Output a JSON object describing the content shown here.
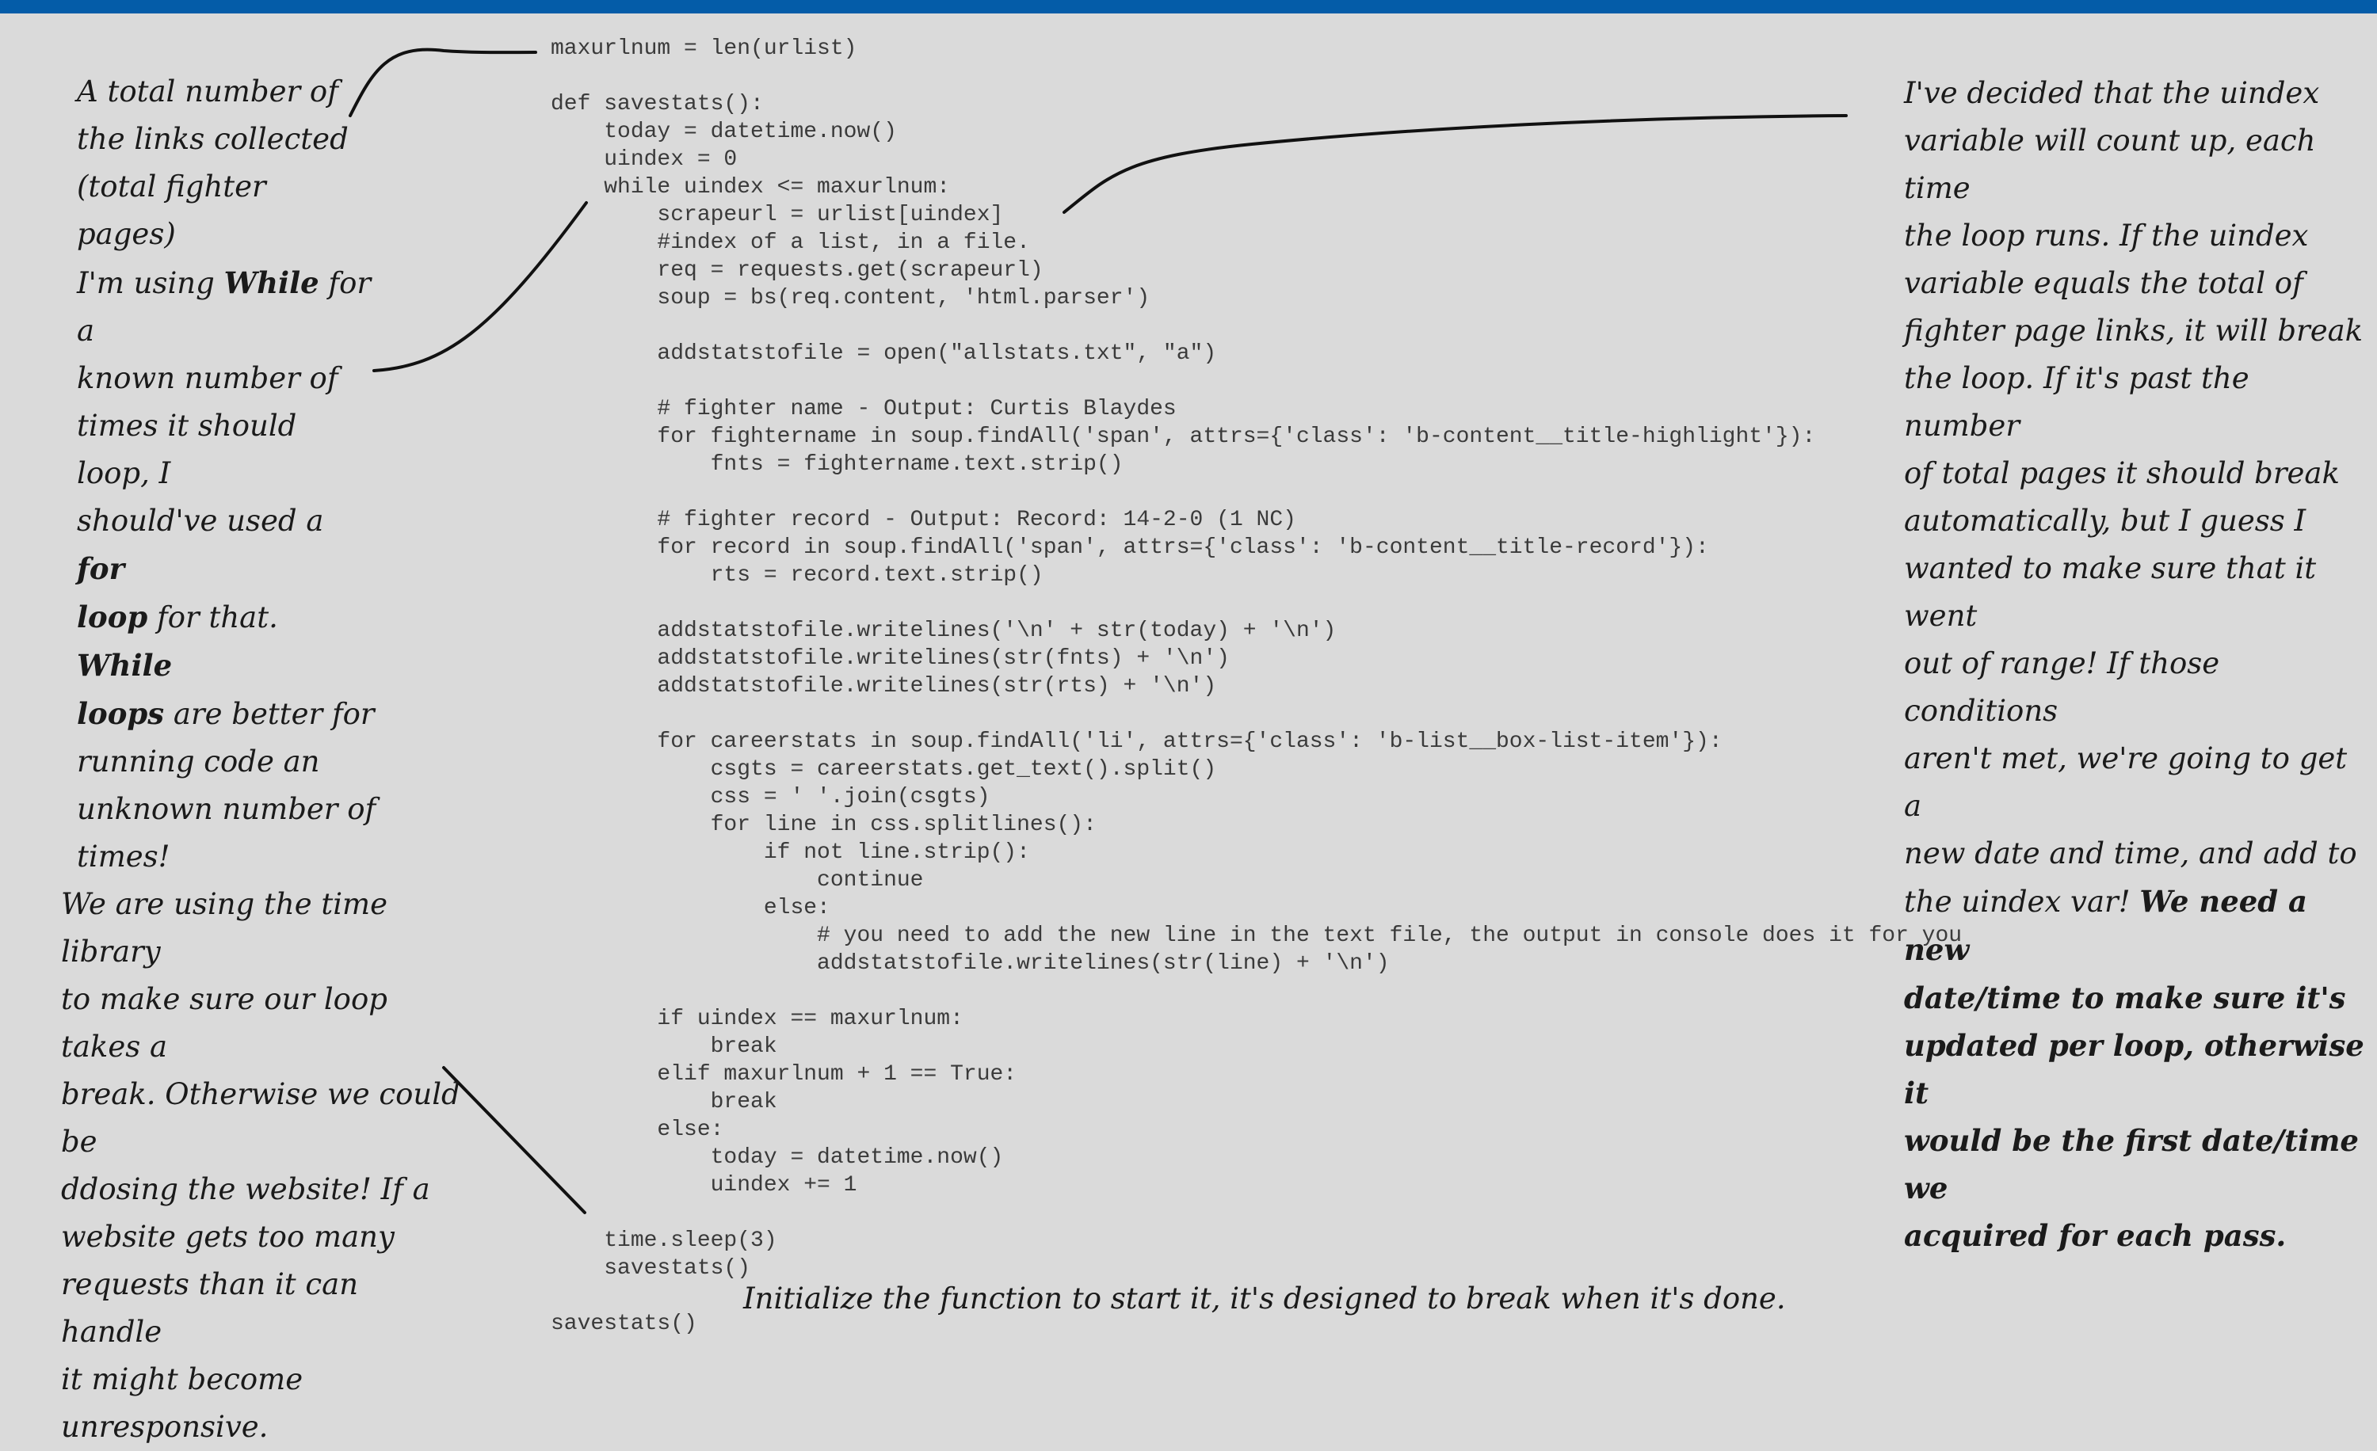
{
  "code_lines": [
    "maxurlnum = len(urlist)",
    "",
    "def savestats():",
    "    today = datetime.now()",
    "    uindex = 0",
    "    while uindex <= maxurlnum:",
    "        scrapeurl = urlist[uindex]",
    "        #index of a list, in a file.",
    "        req = requests.get(scrapeurl)",
    "        soup = bs(req.content, 'html.parser')",
    "",
    "        addstatstofile = open(\"allstats.txt\", \"a\")",
    "",
    "        # fighter name - Output: Curtis Blaydes",
    "        for fightername in soup.findAll('span', attrs={'class': 'b-content__title-highlight'}):",
    "            fnts = fightername.text.strip()",
    "",
    "        # fighter record - Output: Record: 14-2-0 (1 NC)",
    "        for record in soup.findAll('span', attrs={'class': 'b-content__title-record'}):",
    "            rts = record.text.strip()",
    "",
    "        addstatstofile.writelines('\\n' + str(today) + '\\n')",
    "        addstatstofile.writelines(str(fnts) + '\\n')",
    "        addstatstofile.writelines(str(rts) + '\\n')",
    "",
    "        for careerstats in soup.findAll('li', attrs={'class': 'b-list__box-list-item'}):",
    "            csgts = careerstats.get_text().split()",
    "            css = ' '.join(csgts)",
    "            for line in css.splitlines():",
    "                if not line.strip():",
    "                    continue",
    "                else:",
    "                    # you need to add the new line in the text file, the output in console does it for you",
    "                    addstatstofile.writelines(str(line) + '\\n')",
    "",
    "        if uindex == maxurlnum:",
    "            break",
    "        elif maxurlnum + 1 == True:",
    "            break",
    "        else:",
    "            today = datetime.now()",
    "            uindex += 1",
    "",
    "    time.sleep(3)",
    "    savestats()",
    "",
    "savestats()"
  ],
  "notes": {
    "total": {
      "l1": "A total number of",
      "l2": "the links collected",
      "l3": "(total fighter pages)"
    },
    "while": {
      "l1_a": "I'm using ",
      "l1_b": "While",
      "l1_c": " for a",
      "l2": "known number of",
      "l3": "times it should loop, I",
      "l4_a": "should've used a ",
      "l4_b": "for",
      "l5_a": "loop",
      "l5_b": " for that. ",
      "l5_c": "While",
      "l6_a": "loops",
      "l6_b": " are better for",
      "l7": "running code an",
      "l8": "unknown number of",
      "l9": "times!"
    },
    "uindex": {
      "l1": "I've decided that the uindex",
      "l2": "variable will count up, each time",
      "l3": "the loop runs. If the uindex",
      "l4": "variable equals the total of",
      "l5": "fighter page links, it will break",
      "l6": "the loop. If it's past the number",
      "l7": "of total pages it should break",
      "l8": "automatically, but I guess I",
      "l9": "wanted to make sure that it went",
      "l10": "out of range! If those conditions",
      "l11": "aren't met, we're going to get a",
      "l12": "new date and time, and add to",
      "l13_a": "the uindex var! ",
      "l13_b": "We need a new",
      "l14": "date/time to make sure it's",
      "l15": "updated per loop, otherwise it",
      "l16": "would be the first date/time we",
      "l17": "acquired for each pass."
    },
    "time": {
      "l1": "We are using the time library",
      "l2": "to make sure our loop takes a",
      "l3": "break. Otherwise we could be",
      "l4": "ddosing the website!  If a",
      "l5": "website gets too many",
      "l6": "requests than it can handle",
      "l7": "it might become unresponsive."
    },
    "init": "Initialize the function to start it, it's designed to break when it's done."
  },
  "colors": {
    "background": "#dadada",
    "topbar": "#045ca8",
    "code_text": "#3a3a3a",
    "note_text": "#1a1a1a"
  }
}
